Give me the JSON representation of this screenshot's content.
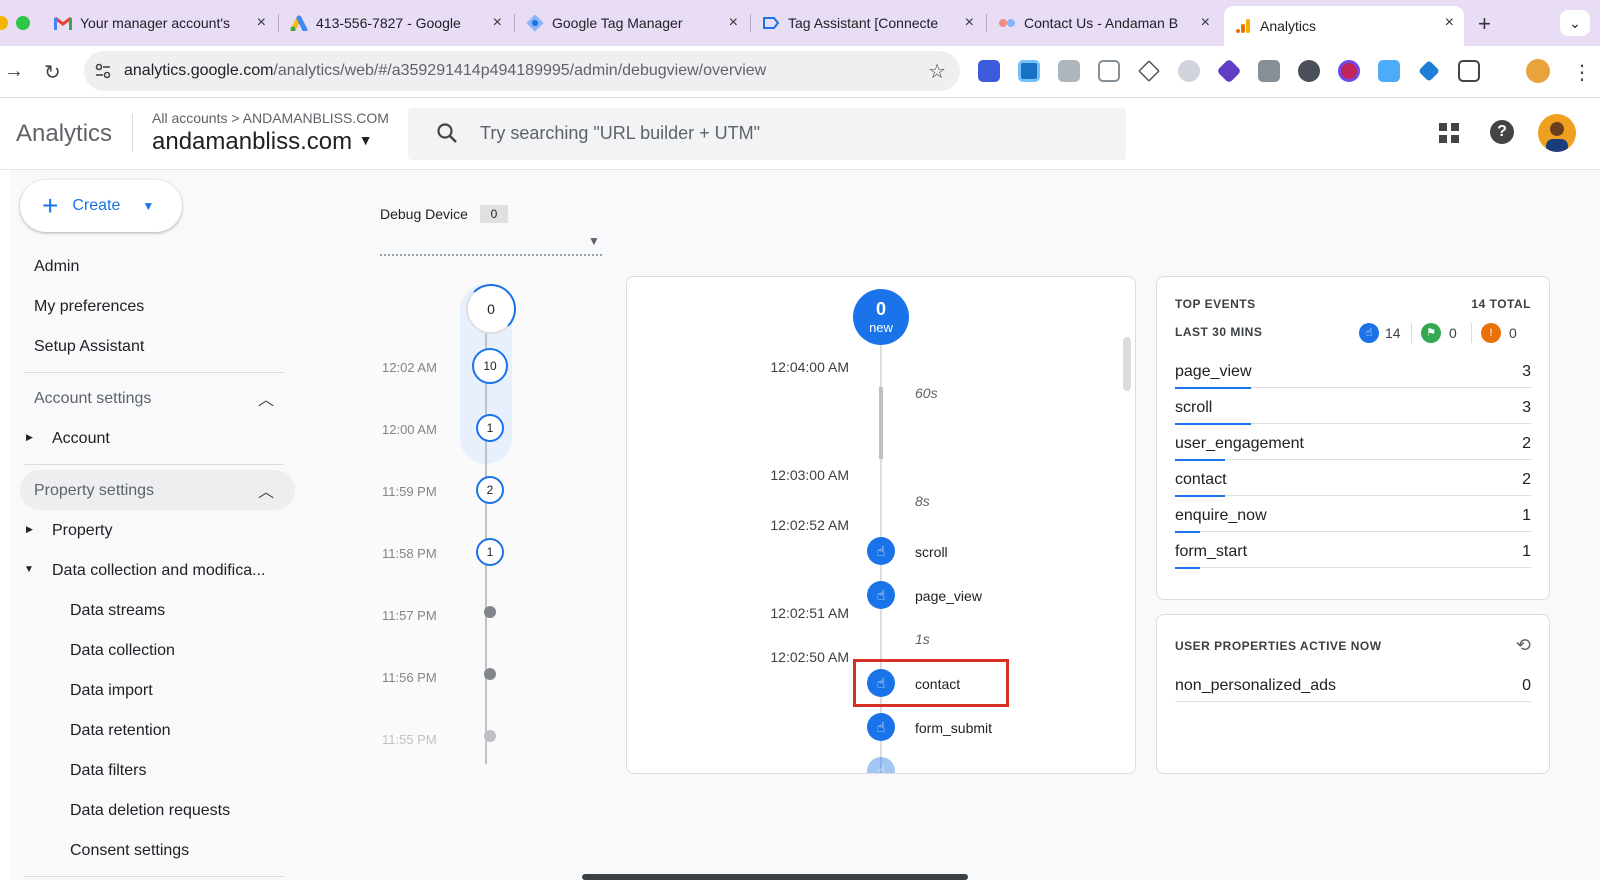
{
  "browser": {
    "tabs": [
      {
        "title": "Your manager account's",
        "icon": "gmail-icon",
        "close": "×"
      },
      {
        "title": "413-556-7827 - Google",
        "icon": "google-ads-icon",
        "close": "×"
      },
      {
        "title": "Google Tag Manager",
        "icon": "gtm-icon",
        "close": "×"
      },
      {
        "title": "Tag Assistant [Connecte",
        "icon": "tag-assistant-icon",
        "close": "×"
      },
      {
        "title": "Contact Us - Andaman B",
        "icon": "site-icon",
        "close": "×"
      },
      {
        "title": "Analytics",
        "icon": "analytics-icon",
        "close": "×",
        "active": true
      }
    ],
    "new_tab": "+",
    "tab_menu": "⌄",
    "url_host": "analytics.google.com",
    "url_path": "/analytics/web/#/a359291414p494189995/admin/debugview/overview"
  },
  "ga": {
    "title": "Analytics",
    "breadcrumb": "All accounts > ANDAMANBLISS.COM",
    "property": "andamanbliss.com",
    "search_placeholder": "Try searching \"URL builder + UTM\""
  },
  "nav": {
    "create": "Create",
    "admin": "Admin",
    "my_preferences": "My preferences",
    "setup_assistant": "Setup Assistant",
    "account_settings": "Account settings",
    "account": "Account",
    "property_settings": "Property settings",
    "property": "Property",
    "data_collection_mod": "Data collection and modifica...",
    "data_streams": "Data streams",
    "data_collection": "Data collection",
    "data_import": "Data import",
    "data_retention": "Data retention",
    "data_filters": "Data filters",
    "data_deletion": "Data deletion requests",
    "consent_settings": "Consent settings"
  },
  "debug": {
    "device_label": "Debug Device",
    "device_count": "0",
    "minutes": [
      {
        "time": "",
        "count": "0"
      },
      {
        "time": "12:02 AM",
        "count": "10"
      },
      {
        "time": "12:00 AM",
        "count": "1"
      },
      {
        "time": "11:59 PM",
        "count": "2"
      },
      {
        "time": "11:58 PM",
        "count": "1"
      },
      {
        "time": "11:57 PM",
        "count": ""
      },
      {
        "time": "11:56 PM",
        "count": ""
      },
      {
        "time": "11:55 PM",
        "count": ""
      }
    ],
    "seconds": {
      "new_count": "0",
      "new_label": "new",
      "t1": "12:04:00 AM",
      "gap1": "60s",
      "t2": "12:03:00 AM",
      "gap2": "8s",
      "t3": "12:02:52 AM",
      "ev1": "scroll",
      "ev2": "page_view",
      "t4": "12:02:51 AM",
      "gap3": "1s",
      "t5": "12:02:50 AM",
      "ev3": "contact",
      "ev4": "form_submit"
    }
  },
  "top_events": {
    "title": "TOP EVENTS",
    "total": "14 TOTAL",
    "period": "LAST 30 MINS",
    "events_count": "14",
    "conversions_count": "0",
    "errors_count": "0",
    "rows": [
      {
        "name": "page_view",
        "count": "3",
        "share": 0.21
      },
      {
        "name": "scroll",
        "count": "3",
        "share": 0.21
      },
      {
        "name": "user_engagement",
        "count": "2",
        "share": 0.14
      },
      {
        "name": "contact",
        "count": "2",
        "share": 0.14
      },
      {
        "name": "enquire_now",
        "count": "1",
        "share": 0.07
      },
      {
        "name": "form_start",
        "count": "1",
        "share": 0.07
      }
    ]
  },
  "user_props": {
    "title": "USER PROPERTIES ACTIVE NOW",
    "name": "non_personalized_ads",
    "value": "0"
  },
  "colors": {
    "accent": "#1a73e8",
    "highlight": "#d93025"
  }
}
